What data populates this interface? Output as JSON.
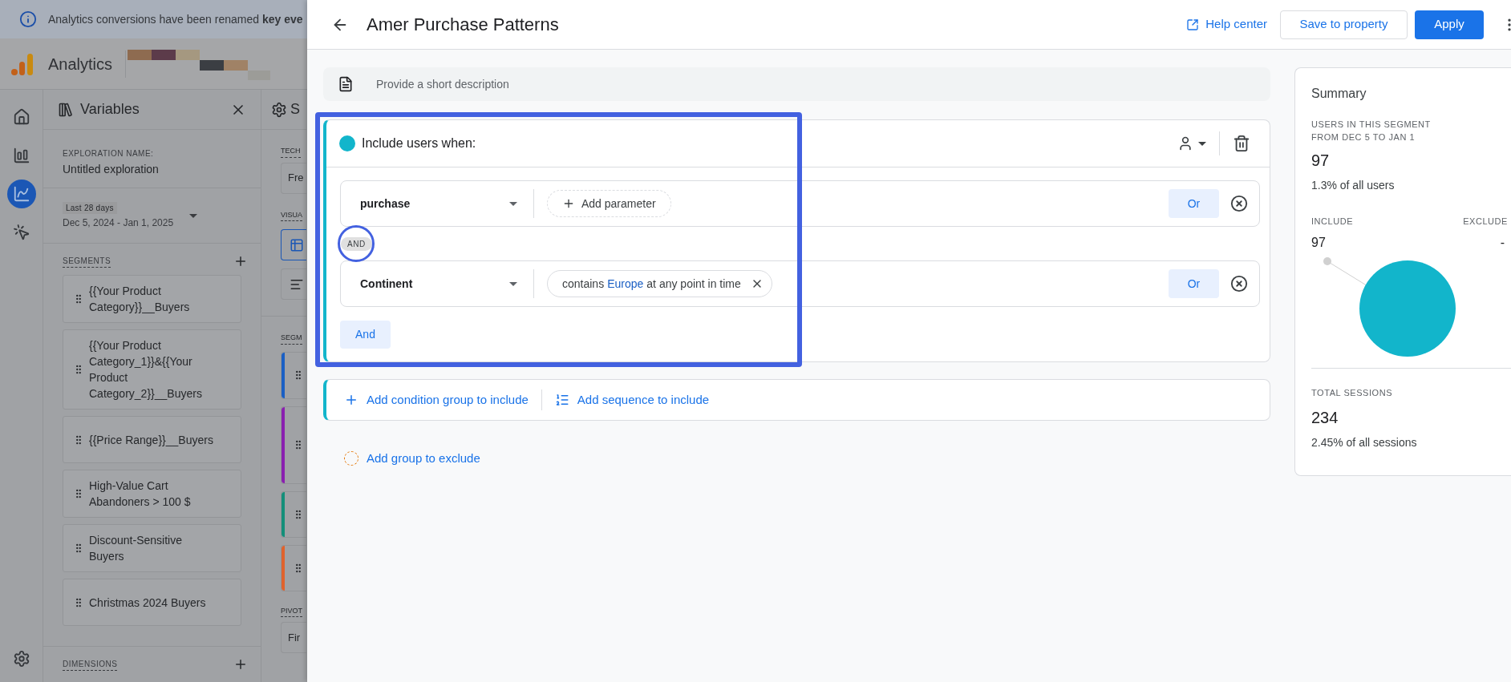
{
  "banner": {
    "text": "Analytics conversions have been renamed **key eve**"
  },
  "app": {
    "name": "Analytics"
  },
  "nav_rail": {
    "items": [
      {
        "kind": "home",
        "selected": false
      },
      {
        "kind": "reports",
        "selected": false
      },
      {
        "kind": "explore",
        "selected": true
      },
      {
        "kind": "advertising",
        "selected": false
      }
    ]
  },
  "variables_panel": {
    "title": "Variables",
    "exploration_name_label": "EXPLORATION NAME:",
    "exploration_name": "Untitled exploration",
    "date_range_label": "Last 28 days",
    "date_range": "Dec 5, 2024 - Jan 1, 2025",
    "segments_heading": "SEGMENTS",
    "segments": [
      "{{Your Product Category}}__Buyers",
      "{{Your Product Category_1}}&{{Your Product Category_2}}__Buyers",
      "{{Price Range}}__Buyers",
      "High-Value Cart Abandoners > 100 $",
      "Discount-Sensitive Buyers",
      "Christmas 2024 Buyers"
    ],
    "dimensions_heading": "DIMENSIONS"
  },
  "settings_panel": {
    "title": "S",
    "technique_heading": "TECH",
    "technique_value": "Fre",
    "visualization_heading": "VISUA",
    "visualizations": [
      {
        "kind": "table",
        "selected": true
      },
      {
        "kind": "bar",
        "selected": false
      }
    ],
    "segment_heading": "SEGM",
    "segment_slots": [
      {
        "color": "#1a5fc4"
      },
      {
        "color": "#8a1fb0"
      },
      {
        "color": "#138f7a"
      },
      {
        "color": "#e0622c"
      }
    ],
    "pivot_heading": "PIVOT",
    "pivot_value": "Fir"
  },
  "segment_editor": {
    "title": "Amer Purchase Patterns",
    "help_link": "Help center",
    "save_button": "Save to property",
    "apply_button": "Apply",
    "description_placeholder": "Provide a short description",
    "include_group": {
      "heading": "Include users when:",
      "conditions": [
        {
          "field": "purchase",
          "kind": "add_parameter",
          "filter_parts": [
            {
              "text": "Add parameter",
              "highlight": false
            }
          ],
          "or_button": "Or"
        },
        {
          "field": "Continent",
          "kind": "chip",
          "filter_parts": [
            {
              "text": "contains",
              "highlight": false
            },
            {
              "text": "Europe",
              "highlight": true
            },
            {
              "text": "at any point in time",
              "highlight": false
            }
          ],
          "or_button": "Or"
        }
      ],
      "joiner": "AND",
      "and_button": "And"
    },
    "add_condition_group": "Add condition group to include",
    "add_sequence": "Add sequence to include",
    "add_exclude": "Add group to exclude"
  },
  "summary": {
    "title": "Summary",
    "users_label_line1": "USERS IN THIS SEGMENT",
    "users_label_line2": "FROM DEC 5 TO JAN 1",
    "users_value": "97",
    "users_share": "1.3% of all users",
    "include_label": "INCLUDE",
    "exclude_label": "EXCLUDE",
    "include_value": "97",
    "exclude_value": "-",
    "sessions_label": "TOTAL SESSIONS",
    "sessions_value": "234",
    "sessions_share": "2.45% of all sessions"
  }
}
